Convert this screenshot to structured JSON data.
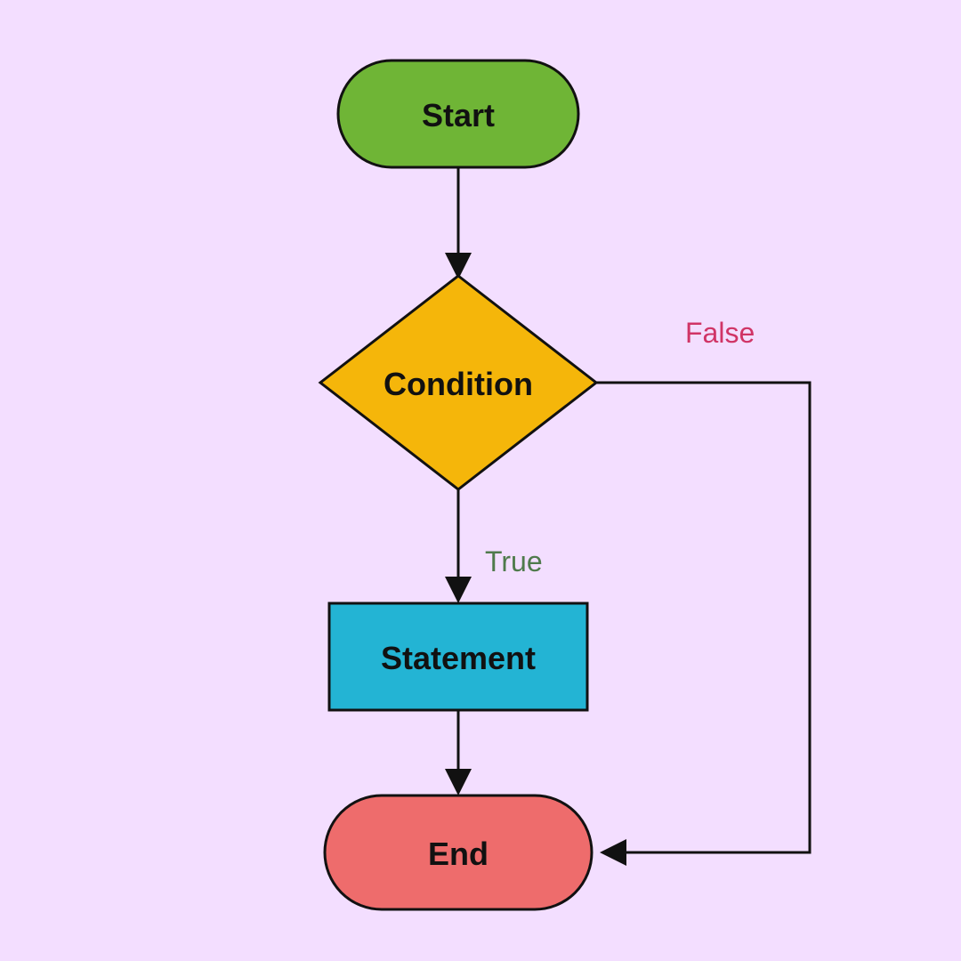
{
  "nodes": {
    "start": {
      "label": "Start",
      "fill": "#6fb536"
    },
    "condition": {
      "label": "Condition",
      "fill": "#f5b60a"
    },
    "statement": {
      "label": "Statement",
      "fill": "#23b4d4"
    },
    "end": {
      "label": "End",
      "fill": "#ee6c6c"
    }
  },
  "edges": {
    "true": {
      "label": "True",
      "color": "#4f7a4c"
    },
    "false": {
      "label": "False",
      "color": "#d03466"
    }
  }
}
